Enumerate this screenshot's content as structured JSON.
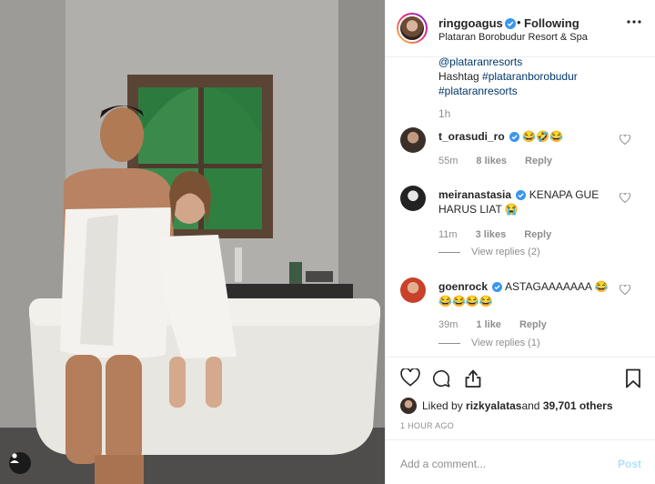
{
  "post": {
    "username": "ringgoagus",
    "follow_dot": "•",
    "follow_status": "Following",
    "location": "Plataran Borobudur Resort & Spa",
    "caption_lines": {
      "line1": "@plataranresorts",
      "line2_prefix": "Hashtag ",
      "line2_tag": "#plataranborobudur",
      "line3": "#plataranresorts"
    },
    "caption_time": "1h"
  },
  "comments": [
    {
      "username": "t_orasudi_ro",
      "text": "😂🤣😂",
      "time": "55m",
      "likes": "8 likes",
      "reply": "Reply"
    },
    {
      "username": "meiranastasia",
      "text": "KENAPA GUE HARUS LIAT 😭",
      "time": "11m",
      "likes": "3 likes",
      "reply": "Reply",
      "view_replies": "View replies (2)"
    },
    {
      "username": "goenrock",
      "text": "ASTAGAAAAAAA 😂 😂😂😂😂",
      "time": "39m",
      "likes": "1 like",
      "reply": "Reply",
      "view_replies": "View replies (1)"
    }
  ],
  "footer": {
    "liked_by_prefix": "Liked by ",
    "liked_by_user": "rizkyalatas",
    "liked_by_and": " and ",
    "liked_by_others": "39,701 others",
    "time_ago": "1 HOUR AGO",
    "comment_placeholder": "Add a comment...",
    "post_label": "Post"
  },
  "icons": {
    "header_more": "more-horizontal-icon",
    "verified": "verified-badge-icon",
    "like": "heart-icon",
    "comment": "comment-icon",
    "share": "share-icon",
    "save": "bookmark-icon",
    "user_tag": "person-tag-icon"
  },
  "colors": {
    "verified": "#3897f0",
    "link": "#00376b",
    "muted": "#8e8e8e",
    "post_disabled": "#b2dffc"
  }
}
